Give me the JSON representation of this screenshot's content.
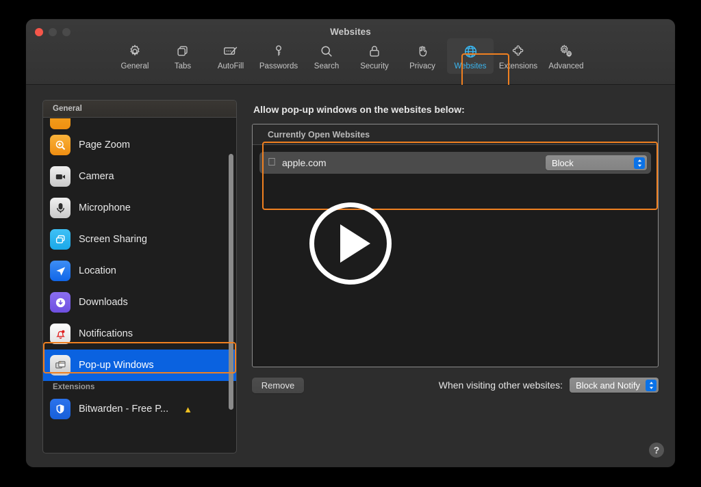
{
  "window": {
    "title": "Websites",
    "traffic_lights": [
      "close",
      "minimize",
      "zoom"
    ]
  },
  "toolbar": {
    "items": [
      {
        "label": "General",
        "icon": "gear-icon",
        "selected": false
      },
      {
        "label": "Tabs",
        "icon": "tabs-icon",
        "selected": false
      },
      {
        "label": "AutoFill",
        "icon": "autofill-icon",
        "selected": false
      },
      {
        "label": "Passwords",
        "icon": "key-icon",
        "selected": false
      },
      {
        "label": "Search",
        "icon": "search-icon",
        "selected": false
      },
      {
        "label": "Security",
        "icon": "lock-icon",
        "selected": false
      },
      {
        "label": "Privacy",
        "icon": "hand-icon",
        "selected": false
      },
      {
        "label": "Websites",
        "icon": "globe-icon",
        "selected": true
      },
      {
        "label": "Extensions",
        "icon": "puzzle-icon",
        "selected": false
      },
      {
        "label": "Advanced",
        "icon": "gears-icon",
        "selected": false
      }
    ],
    "selected_label": "Websites",
    "selected_color": "#3ab6f0"
  },
  "sidebar": {
    "header": "General",
    "items": [
      {
        "label": "Page Zoom",
        "icon": "page-zoom-icon",
        "selected": false
      },
      {
        "label": "Camera",
        "icon": "camera-icon",
        "selected": false
      },
      {
        "label": "Microphone",
        "icon": "microphone-icon",
        "selected": false
      },
      {
        "label": "Screen Sharing",
        "icon": "screen-sharing-icon",
        "selected": false
      },
      {
        "label": "Location",
        "icon": "location-icon",
        "selected": false
      },
      {
        "label": "Downloads",
        "icon": "downloads-icon",
        "selected": false
      },
      {
        "label": "Notifications",
        "icon": "notifications-icon",
        "selected": false
      },
      {
        "label": "Pop-up Windows",
        "icon": "popup-windows-icon",
        "selected": true
      }
    ],
    "group_header": "Extensions",
    "extensions": [
      {
        "label": "Bitwarden - Free P...",
        "icon": "bitwarden-shield-icon",
        "badge": "warning-triangle-icon"
      }
    ],
    "selection_highlight": "#0a62e0"
  },
  "main": {
    "lead_text": "Allow pop-up windows on the websites below:",
    "list": {
      "section_header": "Currently Open Websites",
      "rows": [
        {
          "icon": "apple-logo-icon",
          "site": "apple.com",
          "setting": "Block"
        }
      ]
    },
    "bottom": {
      "remove_label": "Remove",
      "other_sites_label": "When visiting other websites:",
      "other_sites_value": "Block and Notify"
    }
  },
  "overlay": {
    "play_button": "play-icon"
  },
  "help": {
    "label": "?"
  },
  "annotations": {
    "highlight_color": "#f08020",
    "boxes": [
      "websites-tab",
      "currently-open-websites-list",
      "pop-up-windows-sidebar-item"
    ]
  }
}
